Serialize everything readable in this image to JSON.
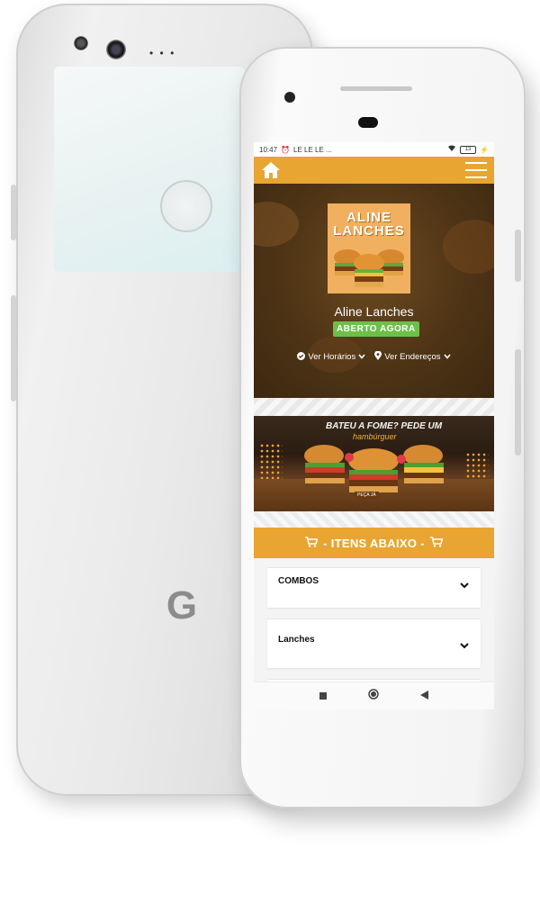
{
  "status_bar": {
    "time": "10:47",
    "indicators": "LE LE LE ...",
    "battery": "13"
  },
  "store": {
    "logo_line1": "ALINE",
    "logo_line2": "LANCHES",
    "name": "Aline Lanches",
    "status_badge": "ABERTO AGORA",
    "hours_link": "Ver Horários",
    "address_link": "Ver Endereços"
  },
  "banner": {
    "headline": "BATEU A FOME? PEDE UM",
    "subline": "hambúrguer",
    "cta": "PEÇA JÁ"
  },
  "items_section": {
    "title": "- ITENS ABAIXO -"
  },
  "categories": [
    {
      "label": "COMBOS"
    },
    {
      "label": "Lanches"
    }
  ],
  "back_phone": {
    "brand_mark": "G"
  },
  "colors": {
    "accent": "#e8a531",
    "badge": "#6cc04a",
    "hero": "#4e3415"
  }
}
